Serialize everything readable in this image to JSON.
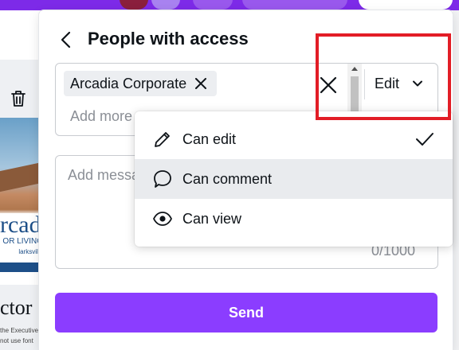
{
  "background": {
    "logo_text": "rcadia",
    "logo_sub": "OR LIVING",
    "logo_location": "larksville",
    "title_fragment": "ctor",
    "text_line_1": "the Executive",
    "text_line_2": "not use font"
  },
  "panel": {
    "title": "People with access",
    "recipient_chip": "Arcadia Corporate",
    "add_more_placeholder": "Add more",
    "permission_label": "Edit",
    "message_placeholder": "Add message",
    "char_counter": "0/1000",
    "send_label": "Send"
  },
  "dropdown": {
    "items": [
      {
        "label": "Can edit",
        "icon": "pencil-icon",
        "selected": true
      },
      {
        "label": "Can comment",
        "icon": "comment-bubble-icon",
        "hovered": true
      },
      {
        "label": "Can view",
        "icon": "eye-icon"
      }
    ]
  },
  "colors": {
    "brand_purple": "#8b3dff",
    "highlight_red": "#e21d26",
    "hover_gray": "#e9ebee"
  }
}
